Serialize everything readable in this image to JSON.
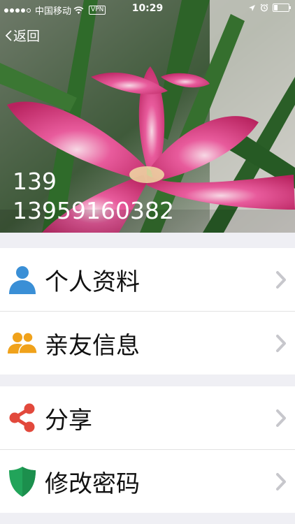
{
  "status_bar": {
    "carrier": "中国移动",
    "vpn": "VPN",
    "time": "10:29",
    "signal_bars": 4,
    "battery_level": 0.25
  },
  "header": {
    "back_label": "返回",
    "user_name": "139",
    "user_phone": "13959160382"
  },
  "menu_groups": [
    {
      "items": [
        {
          "label": "个人资料",
          "icon": "person-icon",
          "icon_color": "#3a8fd6"
        },
        {
          "label": "亲友信息",
          "icon": "people-icon",
          "icon_color": "#f0a21b"
        }
      ]
    },
    {
      "items": [
        {
          "label": "分享",
          "icon": "share-icon",
          "icon_color": "#e2493c"
        },
        {
          "label": "修改密码",
          "icon": "shield-icon",
          "icon_color": "#22a45a"
        }
      ]
    }
  ],
  "colors": {
    "page_background": "#efeff4",
    "chevron": "#c7c7cc"
  }
}
